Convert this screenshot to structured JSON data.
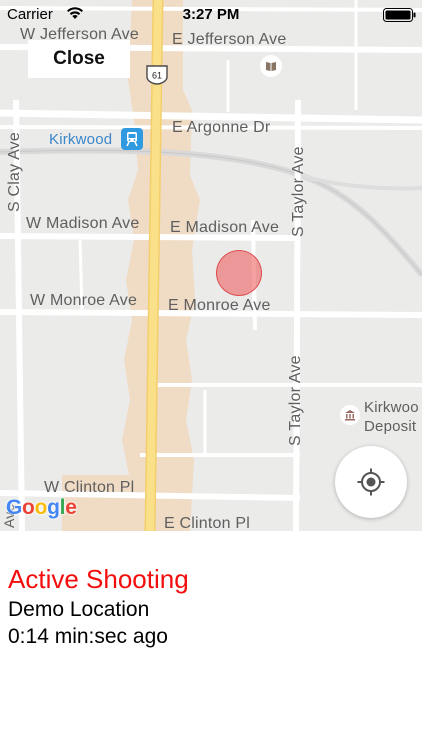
{
  "status_bar": {
    "carrier": "Carrier",
    "time": "3:27 PM",
    "wifi_icon": "wifi-icon",
    "battery_icon": "battery-full-icon"
  },
  "map": {
    "close_label": "Close",
    "streets": {
      "w_jefferson": "W Jefferson Ave",
      "e_jefferson": "E Jefferson Ave",
      "e_argonne": "E Argonne Dr",
      "w_madison": "W Madison Ave",
      "e_madison": "E Madison Ave",
      "w_monroe": "W Monroe Ave",
      "e_monroe": "E Monroe Ave",
      "w_clinton": "W Clinton Pl",
      "e_clinton": "E Clinton Pl",
      "s_clay": "S Clay Ave",
      "s_taylor_upper": "S Taylor Ave",
      "s_taylor_lower": "S Taylor Ave",
      "ave_fragment": "Ave"
    },
    "route_shield": "61",
    "transit_station": "Kirkwood",
    "poi": {
      "line1": "Kirkwoo",
      "line2": "Deposit"
    },
    "google_logo": {
      "letters": [
        "G",
        "o",
        "o",
        "g",
        "l",
        "e"
      ],
      "colors": [
        "#4285F4",
        "#EA4335",
        "#FBBC05",
        "#4285F4",
        "#34A853",
        "#EA4335"
      ]
    },
    "icons": {
      "transit": "train-station-icon",
      "library": "library-icon",
      "museum": "museum-icon",
      "locate": "my-location-icon",
      "route": "route-shield-icon"
    },
    "colors": {
      "map_bg": "#ebebea",
      "road": "#ffffff",
      "highway": "#fbe08a",
      "commercial": "#f0dbc5",
      "incident": "#ec5454"
    }
  },
  "incident": {
    "title": "Active Shooting",
    "location": "Demo Location",
    "elapsed": "0:14 min:sec ago",
    "title_color": "#f40d0d"
  }
}
